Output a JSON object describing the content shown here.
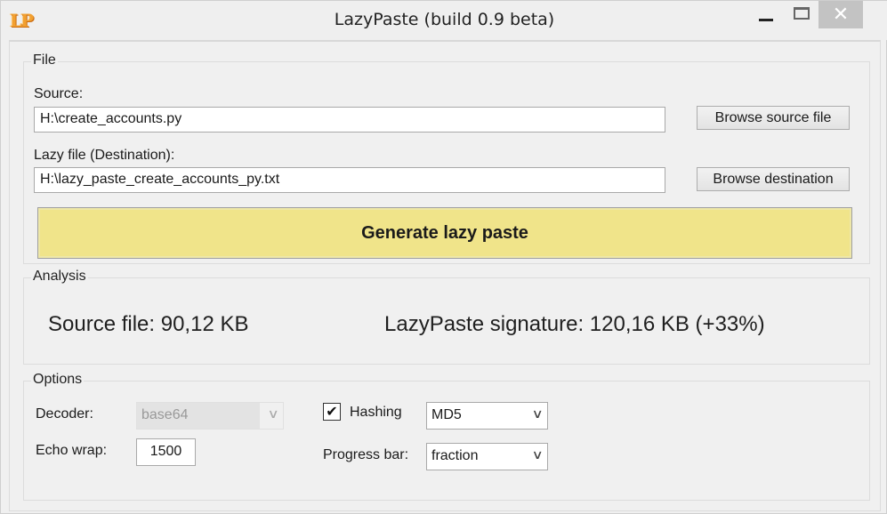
{
  "window": {
    "title": "LazyPaste (build 0.9 beta)",
    "app_icon_text": "LP",
    "controls": {
      "minimize": "minimize",
      "maximize": "maximize",
      "close": "✕"
    }
  },
  "file": {
    "legend": "File",
    "source_label": "Source:",
    "source_value": "H:\\create_accounts.py",
    "browse_source_label": "Browse source file",
    "destination_label": "Lazy file (Destination):",
    "destination_value": "H:\\lazy_paste_create_accounts_py.txt",
    "browse_destination_label": "Browse destination",
    "generate_label": "Generate lazy paste",
    "generate_color": "#f0e48a"
  },
  "analysis": {
    "legend": "Analysis",
    "source_file_text": "Source file: 90,12 KB",
    "signature_text": "LazyPaste signature: 120,16 KB (+33%)"
  },
  "options": {
    "legend": "Options",
    "decoder_label": "Decoder:",
    "decoder_value": "base64",
    "decoder_enabled": false,
    "echo_wrap_label": "Echo wrap:",
    "echo_wrap_value": "1500",
    "hashing_label": "Hashing",
    "hashing_checked": true,
    "hashing_check_glyph": "✔",
    "hashing_value": "MD5",
    "progress_bar_label": "Progress bar:",
    "progress_bar_value": "fraction",
    "dropdown_arrow": "∨"
  }
}
